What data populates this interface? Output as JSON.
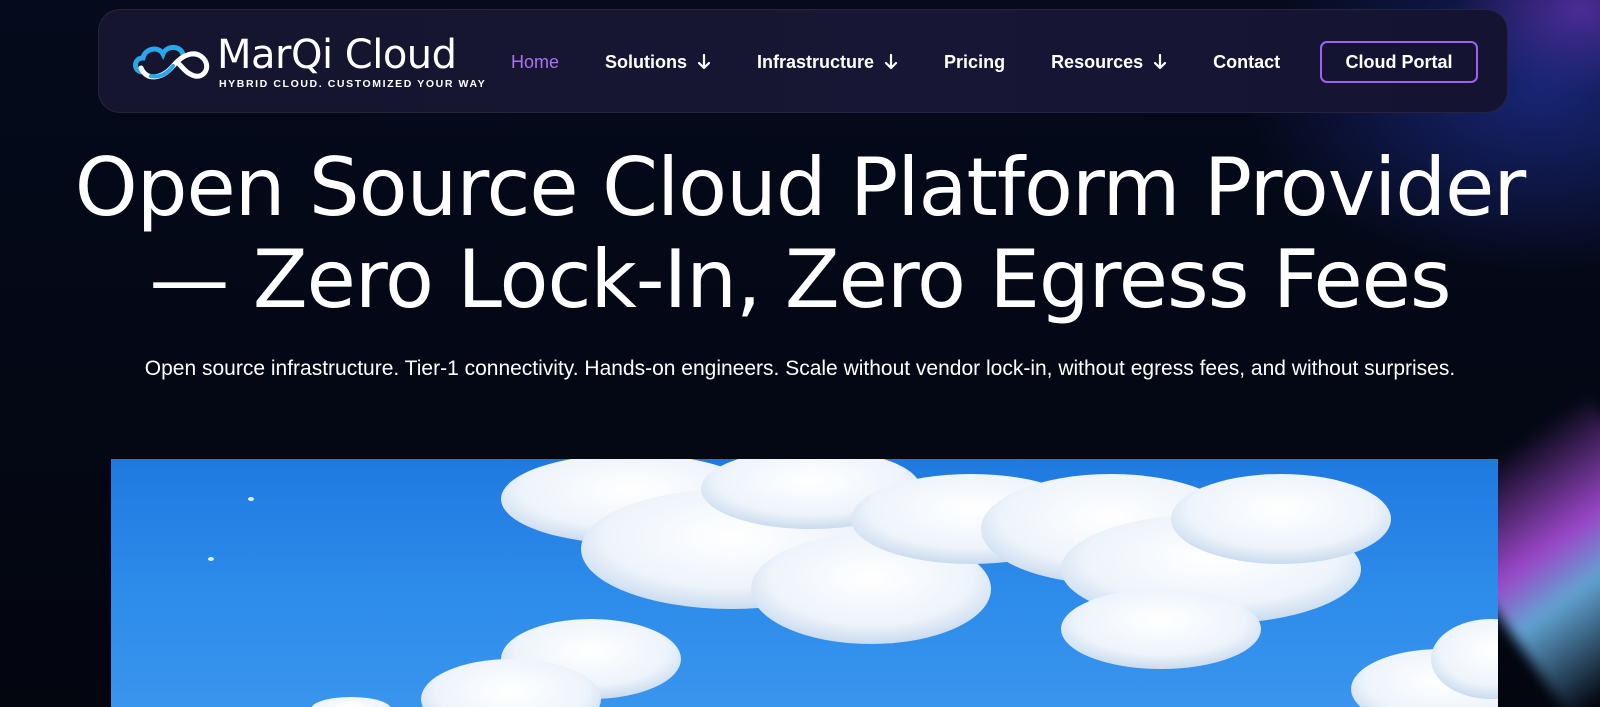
{
  "header": {
    "logo": {
      "title": "MarQi Cloud",
      "tagline": "HYBRID CLOUD. CUSTOMIZED YOUR WAY",
      "icon": "cloud-infinity-icon"
    },
    "nav": [
      {
        "label": "Home",
        "active": true,
        "has_dropdown": false
      },
      {
        "label": "Solutions",
        "active": false,
        "has_dropdown": true
      },
      {
        "label": "Infrastructure",
        "active": false,
        "has_dropdown": true
      },
      {
        "label": "Pricing",
        "active": false,
        "has_dropdown": false
      },
      {
        "label": "Resources",
        "active": false,
        "has_dropdown": true
      },
      {
        "label": "Contact",
        "active": false,
        "has_dropdown": false
      }
    ],
    "cta_label": "Cloud Portal"
  },
  "hero": {
    "title_line1": "Open Source Cloud Platform Provider",
    "title_line2": "— Zero Lock-In, Zero Egress Fees",
    "subtitle": "Open source infrastructure. Tier-1 connectivity. Hands-on engineers. Scale without vendor lock-in, without egress fees, and without surprises.",
    "image": "blue-sky-clouds-photo"
  },
  "colors": {
    "background": "#040816",
    "navbar": "#161532",
    "accent": "#a874f0",
    "button_border": "#9a63f0",
    "logo_blue": "#2aa7e8",
    "sky": "#2d8bea"
  }
}
